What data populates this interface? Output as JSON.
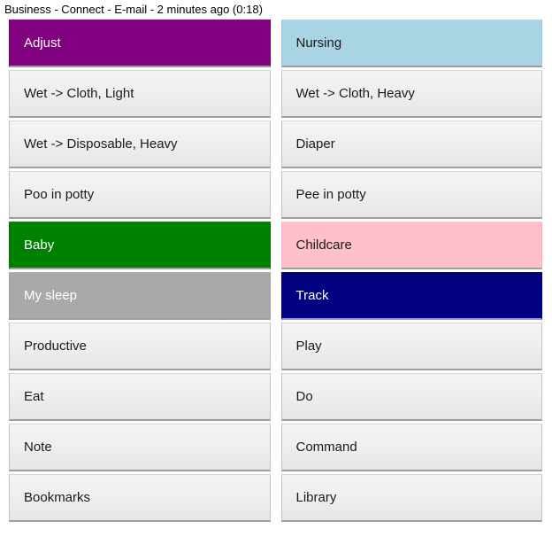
{
  "status_bar": {
    "text": "Business - Connect - E-mail - 2 minutes ago (0:18)"
  },
  "colors": {
    "purple": "#800080",
    "light_blue": "#a9d4e3",
    "green": "#008000",
    "pink": "#ffc0cb",
    "gray": "#a9a9a9",
    "navy": "#000080",
    "default_button": "#efefef",
    "default_text": "#1a1a1a",
    "inverse_text": "#ffffff",
    "page_background": "#ffffff"
  },
  "grid": {
    "columns": 2,
    "rows": [
      {
        "left": {
          "label": "Adjust",
          "style": "purple"
        },
        "right": {
          "label": "Nursing",
          "style": "lightblue"
        }
      },
      {
        "left": {
          "label": "Wet -> Cloth, Light",
          "style": "plain"
        },
        "right": {
          "label": "Wet -> Cloth, Heavy",
          "style": "plain"
        }
      },
      {
        "left": {
          "label": "Wet -> Disposable, Heavy",
          "style": "plain"
        },
        "right": {
          "label": "Diaper",
          "style": "plain"
        }
      },
      {
        "left": {
          "label": "Poo in potty",
          "style": "plain"
        },
        "right": {
          "label": "Pee in potty",
          "style": "plain"
        }
      },
      {
        "left": {
          "label": "Baby",
          "style": "green"
        },
        "right": {
          "label": "Childcare",
          "style": "pink"
        }
      },
      {
        "left": {
          "label": "My sleep",
          "style": "gray"
        },
        "right": {
          "label": "Track",
          "style": "navy"
        }
      },
      {
        "left": {
          "label": "Productive",
          "style": "plain"
        },
        "right": {
          "label": "Play",
          "style": "plain"
        }
      },
      {
        "left": {
          "label": "Eat",
          "style": "plain"
        },
        "right": {
          "label": "Do",
          "style": "plain"
        }
      },
      {
        "left": {
          "label": "Note",
          "style": "plain"
        },
        "right": {
          "label": "Command",
          "style": "plain"
        }
      },
      {
        "left": {
          "label": "Bookmarks",
          "style": "plain"
        },
        "right": {
          "label": "Library",
          "style": "plain"
        }
      }
    ]
  }
}
